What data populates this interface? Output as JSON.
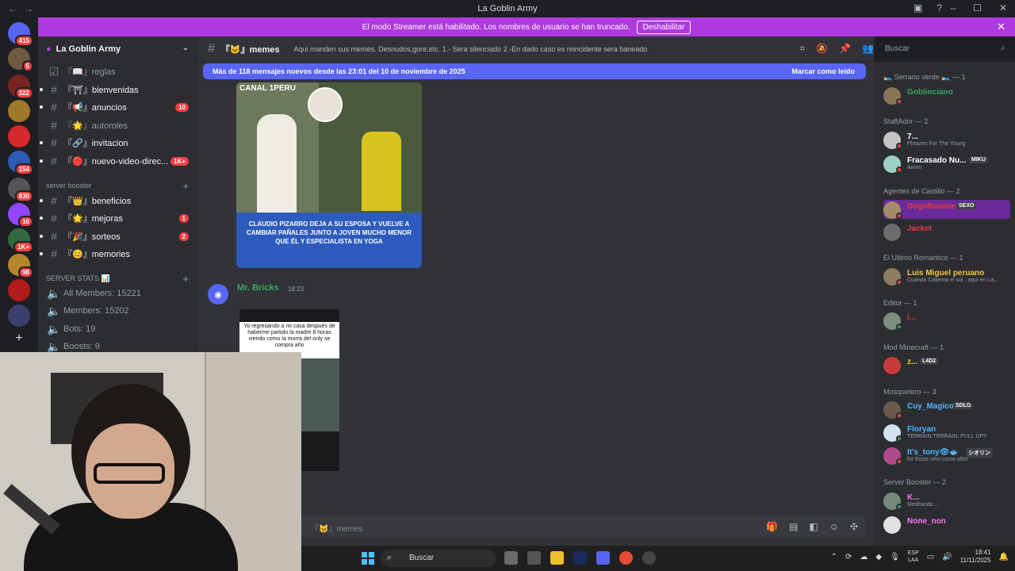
{
  "window": {
    "title": "La Goblin Army"
  },
  "banner": {
    "text": "El modo Streamer está habilitado. Los nombres de usuario se han truncado.",
    "button": "Deshabilitar"
  },
  "server": {
    "name": "La Goblin Army"
  },
  "guild_badges": [
    "415",
    "5",
    "322",
    "154",
    "830",
    "16",
    "1K+",
    "98"
  ],
  "channels": [
    {
      "label": "『📖』reglas",
      "dim": true,
      "badge": ""
    },
    {
      "label": "『⛩』bienvenidas",
      "dim": false,
      "badge": ""
    },
    {
      "label": "『📢』anuncios",
      "dim": false,
      "badge": "10"
    },
    {
      "label": "『🌟』autoroles",
      "dim": true,
      "badge": ""
    },
    {
      "label": "『🔗』invitacion",
      "dim": false,
      "badge": ""
    },
    {
      "label": "『🔴』nuevo-video-direc...",
      "dim": false,
      "badge": "1K+"
    }
  ],
  "booster_category": "server booster",
  "booster_channels": [
    {
      "label": "『👑』beneficios",
      "badge": ""
    },
    {
      "label": "『🌟』mejoras",
      "badge": "1"
    },
    {
      "label": "『🎉』sorteos",
      "badge": "2"
    },
    {
      "label": "『😊』memories",
      "badge": ""
    }
  ],
  "stats_category": "SERVER STATS 📊",
  "stats": [
    "All Members: 15221",
    "Members: 15202",
    "Bots: 19",
    "Boosts: 9"
  ],
  "channel": {
    "name": "『🐱』memes",
    "topic": "Aqui manden sus memes. Desnudos,gore,etc. 1.- Sera silenciado 2.-En dado caso es reincidente sera baneado"
  },
  "search": {
    "placeholder": "Buscar"
  },
  "new_messages": {
    "text": "Más de 118 mensajes nuevos desde las 23:01 del 10 de noviembre de 2025",
    "mark": "Marcar como leído"
  },
  "post1": {
    "logo": "CANAL 1PERU",
    "caption": "CLAUDIO PIZARRO DEJA A SU ESPOSA Y VUELVE A CAMBIAR PAÑALES JUNTO A JOVEN MUCHO MENOR QUE ÉL Y ESPECIALISTA EN YOGA"
  },
  "post2": {
    "author": "Mr. Bricks",
    "time": "18:23",
    "meme_text": "Yo regresando a mi casa después de haberme partido la madre 8 horas viendo como la morra del only se compra año"
  },
  "composer": {
    "placeholder": "『🐱』memes"
  },
  "member_sections": [
    {
      "title": "🛌 Serrano verde 🛌 — 1",
      "members": [
        {
          "name": "Goblinciano",
          "activity": "",
          "color": "#3ba55d",
          "tag": ""
        }
      ]
    },
    {
      "title": "StaffAdor — 2",
      "members": [
        {
          "name": "7...",
          "activity": "Phrazes For The Young",
          "color": "#ffffff",
          "tag": ""
        },
        {
          "name": "Fracasado Nu...",
          "activity": "Amen",
          "color": "#ffffff",
          "tag": "MIKU"
        }
      ]
    },
    {
      "title": "Agentes de Castillo — 2",
      "members": [
        {
          "name": "DogeBanane",
          "activity": "",
          "color": "#e03a3e",
          "tag": "SEXO"
        },
        {
          "name": "Jacket",
          "activity": "",
          "color": "#e03a3e",
          "tag": ""
        }
      ]
    },
    {
      "title": "El Ultimo Romantico — 1",
      "members": [
        {
          "name": "Luis Miguel peruano",
          "activity": "Cuando Calienta el sol , aqui en La...",
          "color": "#f0c93a",
          "tag": ""
        }
      ]
    },
    {
      "title": "Editor — 1",
      "members": [
        {
          "name": "i...",
          "activity": "",
          "color": "#e03a3e",
          "tag": ""
        }
      ]
    },
    {
      "title": "Mod Minecraft — 1",
      "members": [
        {
          "name": "z...",
          "activity": "",
          "color": "#f0c93a",
          "tag": "L4D2"
        }
      ]
    },
    {
      "title": "Mosquetero — 3",
      "members": [
        {
          "name": "Cuy_Magico",
          "activity": "",
          "color": "#4db8ff",
          "tag": "SDLG"
        },
        {
          "name": "Floryan",
          "activity": "TERRAIN TERRAIN, PULL UP!!",
          "color": "#4db8ff",
          "tag": ""
        },
        {
          "name": "It's_tony👁🐟",
          "activity": "for those who come after",
          "color": "#4db8ff",
          "tag": "シオリン"
        }
      ]
    },
    {
      "title": "Server Booster — 2",
      "members": [
        {
          "name": "K...",
          "activity": "Meditando ...",
          "color": "#ff73fa",
          "tag": ""
        },
        {
          "name": "None_non",
          "activity": "",
          "color": "#ff73fa",
          "tag": ""
        }
      ]
    }
  ],
  "taskbar": {
    "search": "Buscar",
    "lang1": "ESP",
    "lang2": "LAA",
    "time": "18:41",
    "date": "11/11/2025"
  },
  "colors": {
    "accent": "#5865f2",
    "banner": "#b039e0",
    "mention": "#f23f43"
  }
}
